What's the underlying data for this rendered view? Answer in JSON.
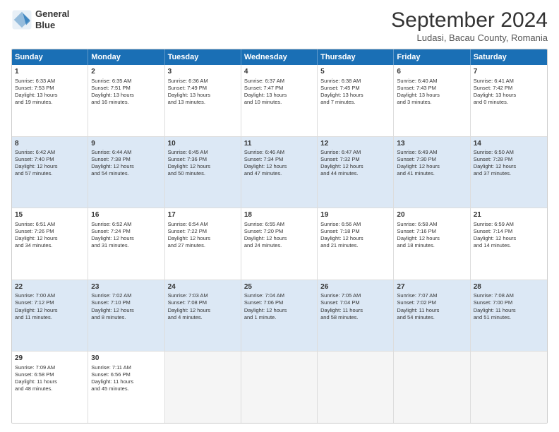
{
  "header": {
    "logo_line1": "General",
    "logo_line2": "Blue",
    "month": "September 2024",
    "location": "Ludasi, Bacau County, Romania"
  },
  "days": [
    "Sunday",
    "Monday",
    "Tuesday",
    "Wednesday",
    "Thursday",
    "Friday",
    "Saturday"
  ],
  "rows": [
    [
      {
        "day": 1,
        "lines": [
          "Sunrise: 6:33 AM",
          "Sunset: 7:53 PM",
          "Daylight: 13 hours",
          "and 19 minutes."
        ]
      },
      {
        "day": 2,
        "lines": [
          "Sunrise: 6:35 AM",
          "Sunset: 7:51 PM",
          "Daylight: 13 hours",
          "and 16 minutes."
        ]
      },
      {
        "day": 3,
        "lines": [
          "Sunrise: 6:36 AM",
          "Sunset: 7:49 PM",
          "Daylight: 13 hours",
          "and 13 minutes."
        ]
      },
      {
        "day": 4,
        "lines": [
          "Sunrise: 6:37 AM",
          "Sunset: 7:47 PM",
          "Daylight: 13 hours",
          "and 10 minutes."
        ]
      },
      {
        "day": 5,
        "lines": [
          "Sunrise: 6:38 AM",
          "Sunset: 7:45 PM",
          "Daylight: 13 hours",
          "and 7 minutes."
        ]
      },
      {
        "day": 6,
        "lines": [
          "Sunrise: 6:40 AM",
          "Sunset: 7:43 PM",
          "Daylight: 13 hours",
          "and 3 minutes."
        ]
      },
      {
        "day": 7,
        "lines": [
          "Sunrise: 6:41 AM",
          "Sunset: 7:42 PM",
          "Daylight: 13 hours",
          "and 0 minutes."
        ]
      }
    ],
    [
      {
        "day": 8,
        "lines": [
          "Sunrise: 6:42 AM",
          "Sunset: 7:40 PM",
          "Daylight: 12 hours",
          "and 57 minutes."
        ]
      },
      {
        "day": 9,
        "lines": [
          "Sunrise: 6:44 AM",
          "Sunset: 7:38 PM",
          "Daylight: 12 hours",
          "and 54 minutes."
        ]
      },
      {
        "day": 10,
        "lines": [
          "Sunrise: 6:45 AM",
          "Sunset: 7:36 PM",
          "Daylight: 12 hours",
          "and 50 minutes."
        ]
      },
      {
        "day": 11,
        "lines": [
          "Sunrise: 6:46 AM",
          "Sunset: 7:34 PM",
          "Daylight: 12 hours",
          "and 47 minutes."
        ]
      },
      {
        "day": 12,
        "lines": [
          "Sunrise: 6:47 AM",
          "Sunset: 7:32 PM",
          "Daylight: 12 hours",
          "and 44 minutes."
        ]
      },
      {
        "day": 13,
        "lines": [
          "Sunrise: 6:49 AM",
          "Sunset: 7:30 PM",
          "Daylight: 12 hours",
          "and 41 minutes."
        ]
      },
      {
        "day": 14,
        "lines": [
          "Sunrise: 6:50 AM",
          "Sunset: 7:28 PM",
          "Daylight: 12 hours",
          "and 37 minutes."
        ]
      }
    ],
    [
      {
        "day": 15,
        "lines": [
          "Sunrise: 6:51 AM",
          "Sunset: 7:26 PM",
          "Daylight: 12 hours",
          "and 34 minutes."
        ]
      },
      {
        "day": 16,
        "lines": [
          "Sunrise: 6:52 AM",
          "Sunset: 7:24 PM",
          "Daylight: 12 hours",
          "and 31 minutes."
        ]
      },
      {
        "day": 17,
        "lines": [
          "Sunrise: 6:54 AM",
          "Sunset: 7:22 PM",
          "Daylight: 12 hours",
          "and 27 minutes."
        ]
      },
      {
        "day": 18,
        "lines": [
          "Sunrise: 6:55 AM",
          "Sunset: 7:20 PM",
          "Daylight: 12 hours",
          "and 24 minutes."
        ]
      },
      {
        "day": 19,
        "lines": [
          "Sunrise: 6:56 AM",
          "Sunset: 7:18 PM",
          "Daylight: 12 hours",
          "and 21 minutes."
        ]
      },
      {
        "day": 20,
        "lines": [
          "Sunrise: 6:58 AM",
          "Sunset: 7:16 PM",
          "Daylight: 12 hours",
          "and 18 minutes."
        ]
      },
      {
        "day": 21,
        "lines": [
          "Sunrise: 6:59 AM",
          "Sunset: 7:14 PM",
          "Daylight: 12 hours",
          "and 14 minutes."
        ]
      }
    ],
    [
      {
        "day": 22,
        "lines": [
          "Sunrise: 7:00 AM",
          "Sunset: 7:12 PM",
          "Daylight: 12 hours",
          "and 11 minutes."
        ]
      },
      {
        "day": 23,
        "lines": [
          "Sunrise: 7:02 AM",
          "Sunset: 7:10 PM",
          "Daylight: 12 hours",
          "and 8 minutes."
        ]
      },
      {
        "day": 24,
        "lines": [
          "Sunrise: 7:03 AM",
          "Sunset: 7:08 PM",
          "Daylight: 12 hours",
          "and 4 minutes."
        ]
      },
      {
        "day": 25,
        "lines": [
          "Sunrise: 7:04 AM",
          "Sunset: 7:06 PM",
          "Daylight: 12 hours",
          "and 1 minute."
        ]
      },
      {
        "day": 26,
        "lines": [
          "Sunrise: 7:05 AM",
          "Sunset: 7:04 PM",
          "Daylight: 11 hours",
          "and 58 minutes."
        ]
      },
      {
        "day": 27,
        "lines": [
          "Sunrise: 7:07 AM",
          "Sunset: 7:02 PM",
          "Daylight: 11 hours",
          "and 54 minutes."
        ]
      },
      {
        "day": 28,
        "lines": [
          "Sunrise: 7:08 AM",
          "Sunset: 7:00 PM",
          "Daylight: 11 hours",
          "and 51 minutes."
        ]
      }
    ],
    [
      {
        "day": 29,
        "lines": [
          "Sunrise: 7:09 AM",
          "Sunset: 6:58 PM",
          "Daylight: 11 hours",
          "and 48 minutes."
        ]
      },
      {
        "day": 30,
        "lines": [
          "Sunrise: 7:11 AM",
          "Sunset: 6:56 PM",
          "Daylight: 11 hours",
          "and 45 minutes."
        ]
      },
      null,
      null,
      null,
      null,
      null
    ]
  ]
}
